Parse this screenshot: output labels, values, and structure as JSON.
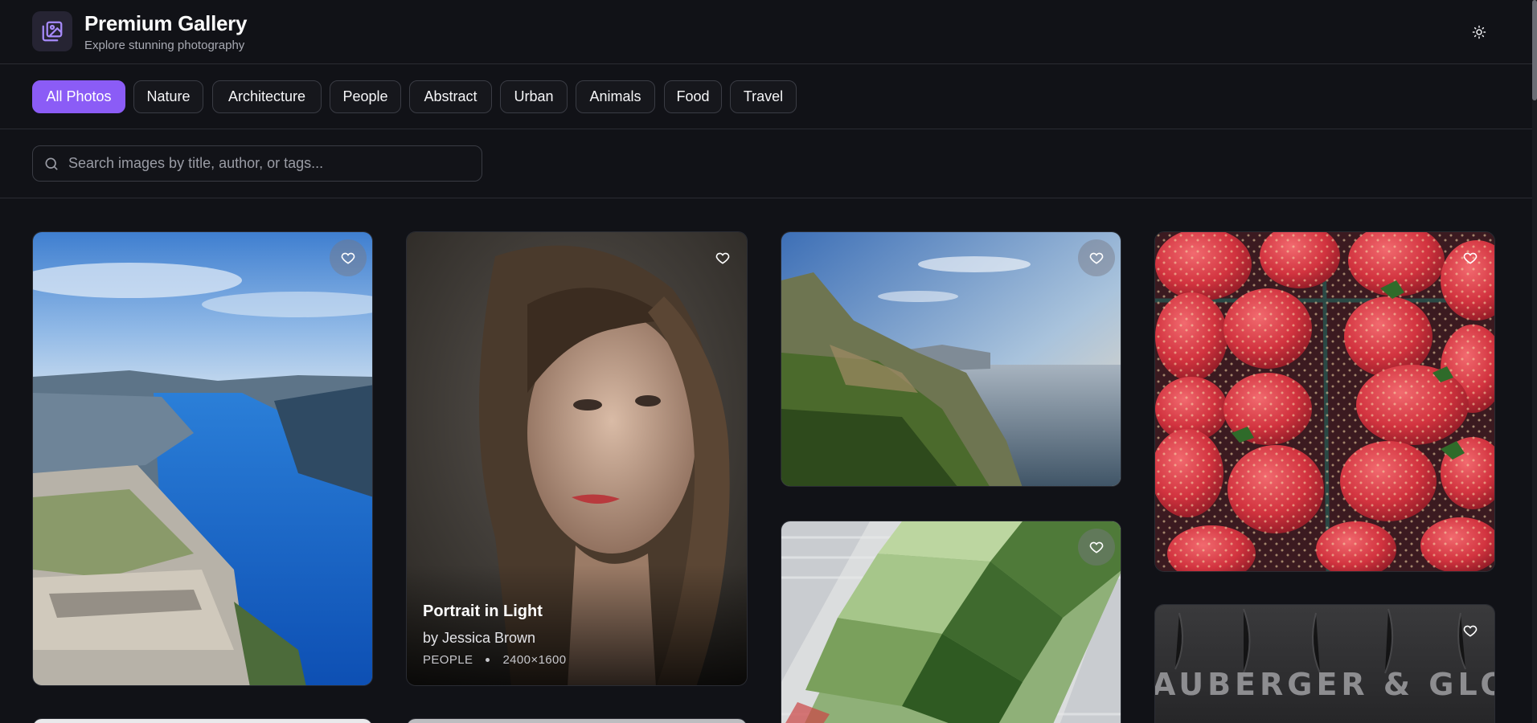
{
  "header": {
    "title": "Premium Gallery",
    "subtitle": "Explore stunning photography"
  },
  "categories": [
    "All Photos",
    "Nature",
    "Architecture",
    "People",
    "Abstract",
    "Urban",
    "Animals",
    "Food",
    "Travel"
  ],
  "active_category": "All Photos",
  "search": {
    "placeholder": "Search images by title, author, or tags...",
    "value": ""
  },
  "cards": [
    {
      "id": "fjord",
      "subject": "fjord cliff landscape"
    },
    {
      "id": "portrait",
      "title": "Portrait in Light",
      "author": "by Jessica Brown",
      "category": "PEOPLE",
      "dimensions": "2400×1600"
    },
    {
      "id": "coast",
      "subject": "coastal cliffs at sunset"
    },
    {
      "id": "strawberries",
      "subject": "strawberries"
    },
    {
      "id": "stadium",
      "subject": "aerial stadium"
    },
    {
      "id": "sign",
      "subject": "metal sign lettering",
      "sign_text": "AUBERGER & GLOS"
    }
  ],
  "colors": {
    "accent": "#8b5cf6",
    "background": "#111217"
  },
  "icons": {
    "logo": "image-gallery-icon",
    "theme": "sun-icon",
    "search": "search-icon",
    "favorite": "heart-icon"
  }
}
